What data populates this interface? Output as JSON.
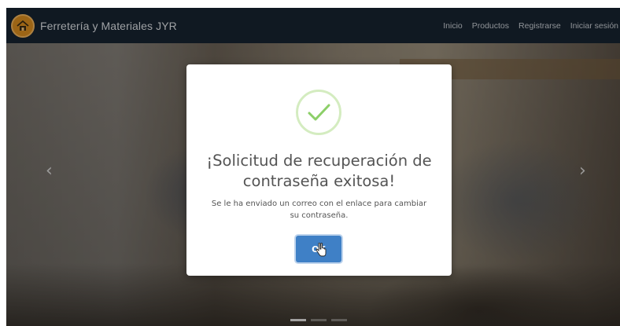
{
  "navbar": {
    "brand_name": "Ferretería y Materiales JYR",
    "links": [
      "Inicio",
      "Productos",
      "Registrarse",
      "Iniciar sesión"
    ]
  },
  "carousel": {
    "prev_icon": "chevron-left-icon",
    "next_icon": "chevron-right-icon",
    "prev_glyph": "‹",
    "next_glyph": "›",
    "indicator_count": 3,
    "active_indicator": 1
  },
  "modal": {
    "icon": "success-check-icon",
    "title": "¡Solicitud de recuperación de contraseña exitosa!",
    "text": "Se le ha enviado un correo con el enlace para cambiar su contraseña.",
    "ok_label": "OK"
  },
  "colors": {
    "navbar_bg": "#172330",
    "success_green": "#8ccf68",
    "ok_button": "#3f80c6",
    "modal_text": "#545454"
  }
}
